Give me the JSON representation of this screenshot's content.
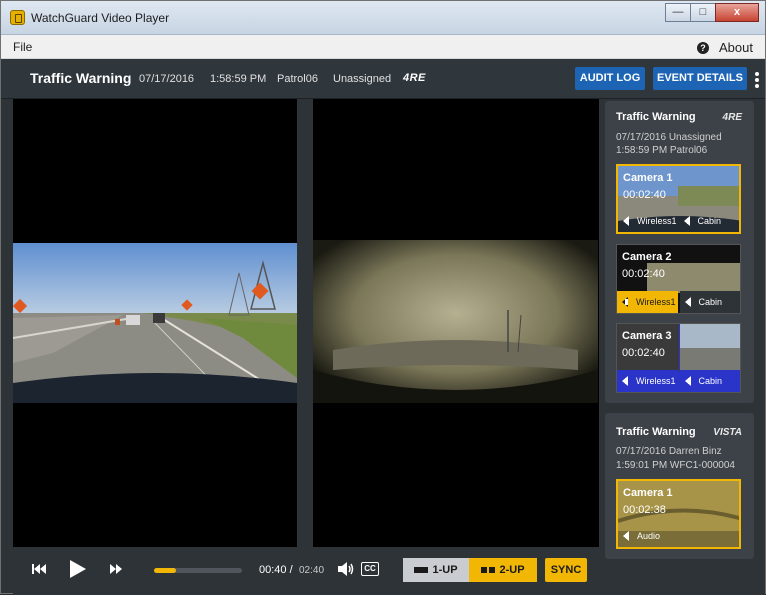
{
  "window": {
    "title": "WatchGuard Video Player",
    "min_label": "—",
    "max_label": "□",
    "close_label": "x"
  },
  "menu": {
    "file": "File",
    "about": "About",
    "help_glyph": "?"
  },
  "header": {
    "title": "Traffic Warning",
    "date": "07/17/2016",
    "time": "1:58:59 PM",
    "officer": "Patrol06",
    "status": "Unassigned",
    "logo": "4RE",
    "audit_log": "AUDIT LOG",
    "event_details": "EVENT DETAILS"
  },
  "events": [
    {
      "title": "Traffic Warning",
      "logo": "4RE",
      "meta_line1": "07/17/2016   Unassigned",
      "meta_line2": "1:58:59 PM   Patrol06",
      "cameras": [
        {
          "name": "Camera 1",
          "time": "00:02:40",
          "audio": [
            {
              "label": "Wireless1",
              "active": false
            },
            {
              "label": "Cabin",
              "active": false
            }
          ],
          "selected": true
        },
        {
          "name": "Camera 2",
          "time": "00:02:40",
          "audio": [
            {
              "label": "Wireless1",
              "active": true
            },
            {
              "label": "Cabin",
              "active": false
            }
          ],
          "selected": false
        },
        {
          "name": "Camera 3",
          "time": "00:02:40",
          "audio": [
            {
              "label": "Wireless1",
              "active": false
            },
            {
              "label": "Cabin",
              "active": false
            }
          ],
          "selected": false
        }
      ]
    },
    {
      "title": "Traffic Warning",
      "logo": "VISTA",
      "meta_line1": "07/17/2016   Darren Binz",
      "meta_line2": "1:59:01 PM   WFC1-000004",
      "cameras": [
        {
          "name": "Camera 1",
          "time": "00:02:38",
          "audio": [
            {
              "label": "Audio",
              "active": false
            }
          ],
          "selected": true
        }
      ]
    }
  ],
  "player": {
    "current_time": "00:40",
    "separator": "/",
    "total_time": "02:40",
    "progress_fraction": 0.25,
    "cc_label": "CC",
    "layout_1up": "1-UP",
    "layout_2up": "2-UP",
    "sync": "SYNC",
    "active_layout": "2-UP"
  },
  "colors": {
    "accent": "#f2b705",
    "blue": "#1e64b5",
    "wireless_active": "#f2b705",
    "cam3_audio": "#2a34c9"
  }
}
